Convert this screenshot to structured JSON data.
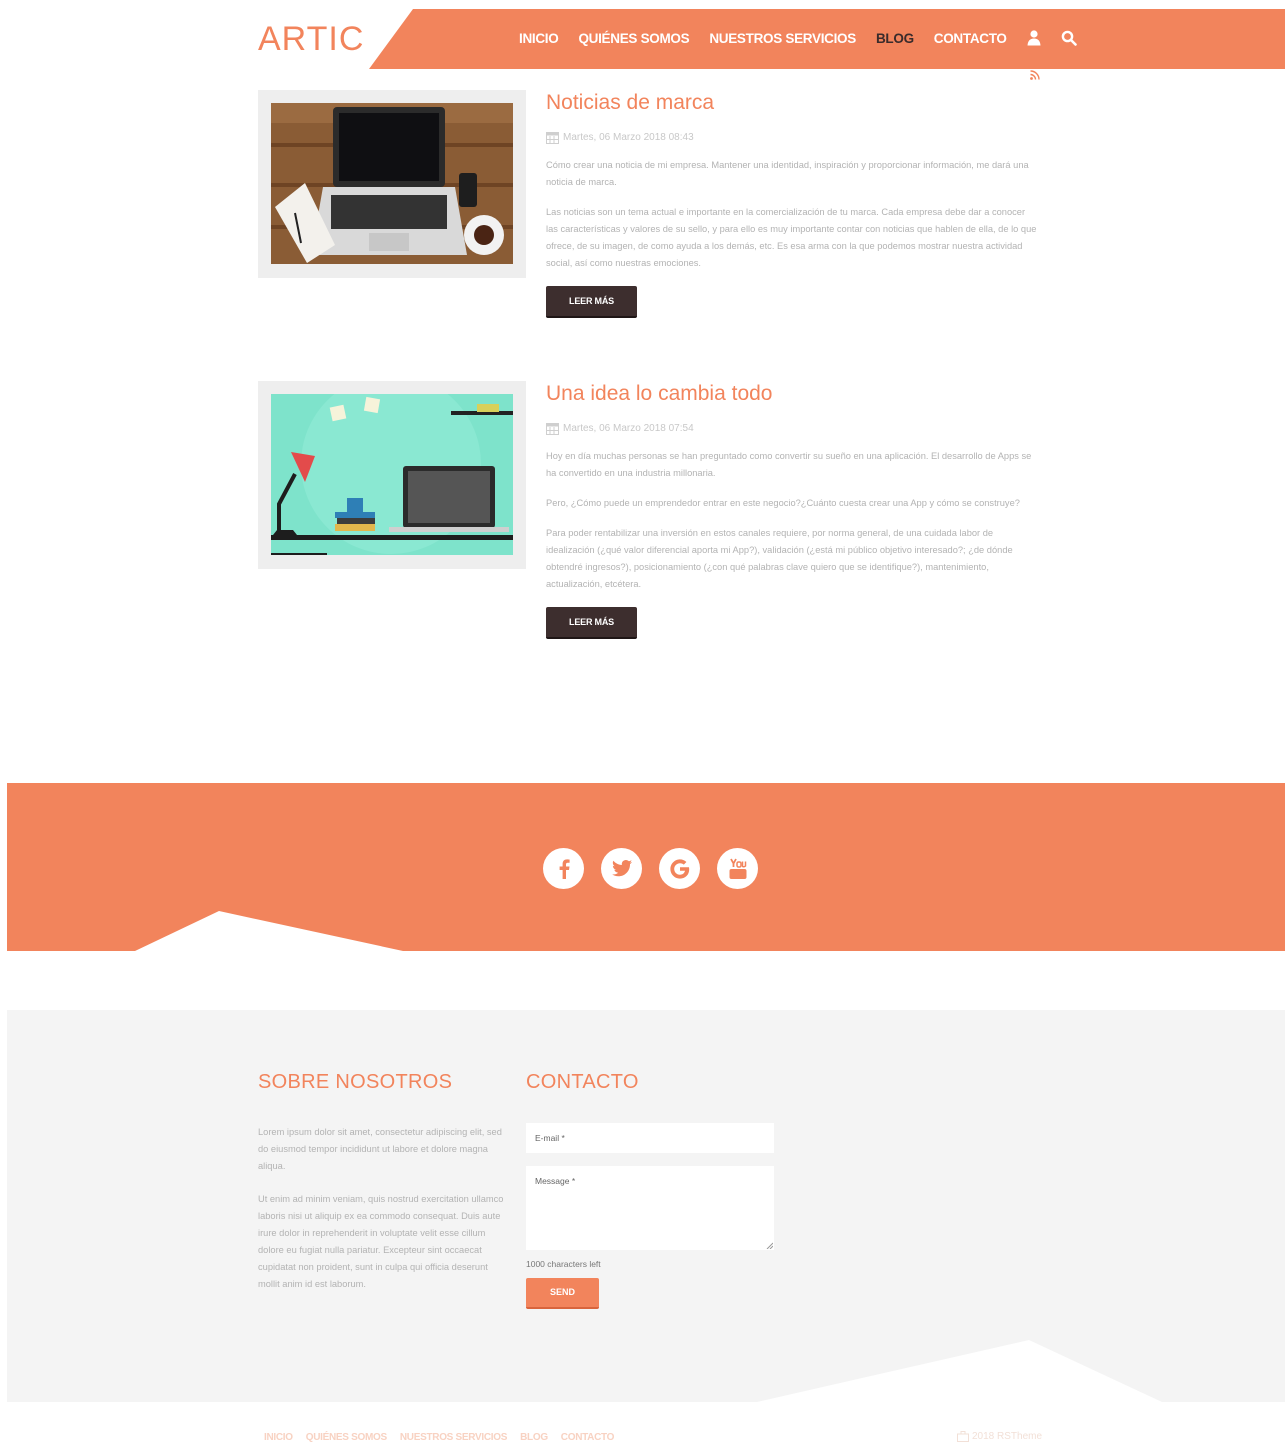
{
  "brand": {
    "logo": "ARTIC",
    "accent": "#f2845c",
    "dark": "#3d2e2e"
  },
  "nav": {
    "items": [
      {
        "label": "INICIO",
        "active": false
      },
      {
        "label": "QUIÉNES SOMOS",
        "active": false
      },
      {
        "label": "NUESTROS SERVICIOS",
        "active": false
      },
      {
        "label": "BLOG",
        "active": true
      },
      {
        "label": "CONTACTO",
        "active": false
      }
    ],
    "icons": [
      "user-icon",
      "search-icon",
      "rss-icon"
    ]
  },
  "articles": [
    {
      "title": "Noticias de marca",
      "date": "Martes, 06 Marzo 2018 08:43",
      "paragraphs": [
        "Cómo crear una noticia de mi empresa. Mantener una identidad, inspiración y proporcionar información, me dará una noticia de marca.",
        "Las noticias son un tema actual e importante en la comercialización de tu marca. Cada empresa debe dar a conocer las características y valores de su sello, y para ello es muy importante contar con noticias que hablen de ella, de lo que ofrece, de su imagen, de como ayuda a los demás, etc. Es esa arma con la que podemos mostrar nuestra actividad social, así como nuestras emociones."
      ],
      "button": "LEER MÁS"
    },
    {
      "title": "Una idea lo cambia todo",
      "date": "Martes, 06 Marzo 2018 07:54",
      "paragraphs": [
        "Hoy en día muchas personas se han preguntado como convertir su sueño en una aplicación. El desarrollo de Apps se ha convertido en una industria millonaria.",
        "Pero, ¿Cómo puede un emprendedor entrar en este negocio?¿Cuánto cuesta crear una App y cómo se construye?",
        "Para poder rentabilizar una inversión en estos canales requiere, por norma general, de una cuidada labor de idealización (¿qué valor diferencial aporta mi App?), validación (¿está mi público objetivo interesado?; ¿de dónde obtendré ingresos?), posicionamiento (¿con qué palabras clave quiero que se identifique?), mantenimiento, actualización, etcétera."
      ],
      "button": "LEER MÁS"
    }
  ],
  "social": [
    "facebook-icon",
    "twitter-icon",
    "google-icon",
    "youtube-icon"
  ],
  "about": {
    "title": "SOBRE NOSOTROS",
    "paragraphs": [
      "Lorem ipsum dolor sit amet, consectetur adipiscing elit, sed do eiusmod tempor incididunt ut labore et dolore magna aliqua.",
      "Ut enim ad minim veniam, quis nostrud exercitation ullamco laboris nisi ut aliquip ex ea commodo consequat. Duis aute irure dolor in reprehenderit in voluptate velit esse cillum dolore eu fugiat nulla pariatur. Excepteur sint occaecat cupidatat non proident, sunt in culpa qui officia deserunt mollit anim id est laborum."
    ]
  },
  "contact": {
    "title": "CONTACTO",
    "email_placeholder": "E-mail *",
    "message_placeholder": "Message *",
    "chars_left": "1000 characters left",
    "send": "SEND"
  },
  "footer": {
    "nav": [
      "INICIO",
      "QUIÉNES SOMOS",
      "NUESTROS SERVICIOS",
      "BLOG",
      "CONTACTO"
    ],
    "copyright": "2018 RSTheme"
  }
}
